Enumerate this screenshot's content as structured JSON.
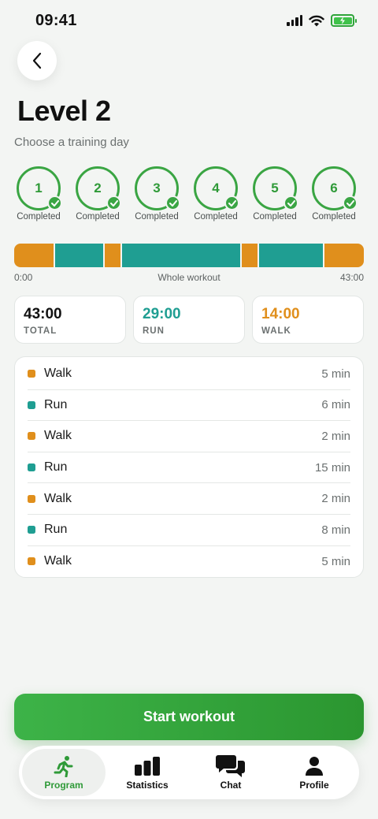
{
  "status_bar": {
    "time": "09:41"
  },
  "header": {
    "title": "Level 2",
    "subtitle": "Choose a training day"
  },
  "days": [
    {
      "number": "1",
      "status": "Completed"
    },
    {
      "number": "2",
      "status": "Completed"
    },
    {
      "number": "3",
      "status": "Completed"
    },
    {
      "number": "4",
      "status": "Completed"
    },
    {
      "number": "5",
      "status": "Completed"
    },
    {
      "number": "6",
      "status": "Completed"
    }
  ],
  "timeline": {
    "start": "0:00",
    "label": "Whole workout",
    "end": "43:00"
  },
  "summary": {
    "total": {
      "value": "43:00",
      "label": "TOTAL"
    },
    "run": {
      "value": "29:00",
      "label": "RUN"
    },
    "walk": {
      "value": "14:00",
      "label": "WALK"
    }
  },
  "intervals": [
    {
      "type": "Walk",
      "duration": "5 min",
      "minutes": 5
    },
    {
      "type": "Run",
      "duration": "6 min",
      "minutes": 6
    },
    {
      "type": "Walk",
      "duration": "2 min",
      "minutes": 2
    },
    {
      "type": "Run",
      "duration": "15 min",
      "minutes": 15
    },
    {
      "type": "Walk",
      "duration": "2 min",
      "minutes": 2
    },
    {
      "type": "Run",
      "duration": "8 min",
      "minutes": 8
    },
    {
      "type": "Walk",
      "duration": "5 min",
      "minutes": 5
    }
  ],
  "start_button": {
    "label": "Start workout"
  },
  "nav": {
    "program": "Program",
    "statistics": "Statistics",
    "chat": "Chat",
    "profile": "Profile",
    "active": "Program"
  },
  "colors": {
    "accent": "#3aa543",
    "run": "#1f9e92",
    "walk": "#e08f1c"
  }
}
